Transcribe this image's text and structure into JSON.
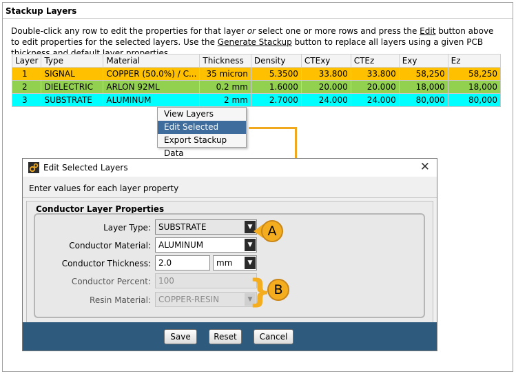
{
  "panel": {
    "title": "Stackup Layers",
    "intro": {
      "p1": "Double-click any row to edit the properties for that layer ",
      "or": "or",
      "p2": " select one or more rows and press the ",
      "edit": "Edit",
      "p3": " button above to edit properties for the selected layers. Use the ",
      "generate": "Generate Stackup",
      "p4": " button to replace all layers using a given PCB thickness and default layer properties."
    }
  },
  "table": {
    "headers": [
      "Layer",
      "Type",
      "Material",
      "Thickness",
      "Density",
      "CTExy",
      "CTEz",
      "Exy",
      "Ez"
    ],
    "rows": [
      {
        "layer": "1",
        "type": "SIGNAL",
        "material": "COPPER (50.0%) / C...",
        "thickness": "35 micron",
        "density": "5.3500",
        "ctexy": "33.800",
        "ctez": "33.800",
        "exy": "58,250",
        "ez": "58,250",
        "color": "#ffc000"
      },
      {
        "layer": "2",
        "type": "DIELECTRIC",
        "material": "ARLON 92ML",
        "thickness": "0.2 mm",
        "density": "1.6000",
        "ctexy": "20.000",
        "ctez": "20.000",
        "exy": "18,000",
        "ez": "18,000",
        "color": "#92d050"
      },
      {
        "layer": "3",
        "type": "SUBSTRATE",
        "material": "ALUMINUM",
        "thickness": "2 mm",
        "density": "2.7000",
        "ctexy": "24.000",
        "ctez": "24.000",
        "exy": "80,000",
        "ez": "80,000",
        "color": "#00ffff"
      }
    ]
  },
  "context_menu": {
    "items": [
      "View Layers",
      "Edit Selected Layers",
      "Export Stackup Data"
    ],
    "selected": "Edit Selected Layers"
  },
  "dialog": {
    "title": "Edit Selected Layers",
    "hint": "Enter values for each layer property",
    "group_title": "Conductor Layer Properties",
    "layer_type": {
      "label": "Layer Type:",
      "value": "SUBSTRATE"
    },
    "conductor_material": {
      "label": "Conductor Material:",
      "value": "ALUMINUM"
    },
    "conductor_thickness": {
      "label": "Conductor Thickness:",
      "value": "2.0",
      "unit": "mm"
    },
    "conductor_percent": {
      "label": "Conductor Percent:",
      "value": "100"
    },
    "resin_material": {
      "label": "Resin Material:",
      "value": "COPPER-RESIN"
    },
    "buttons": {
      "save": "Save",
      "reset": "Reset",
      "cancel": "Cancel"
    },
    "close_glyph": "✕"
  },
  "callouts": {
    "a": "A",
    "b": "B"
  },
  "colors": {
    "accent": "#f4ad1f",
    "button_bar": "#2e5a7d",
    "menu_selected": "#3e6c9c"
  }
}
